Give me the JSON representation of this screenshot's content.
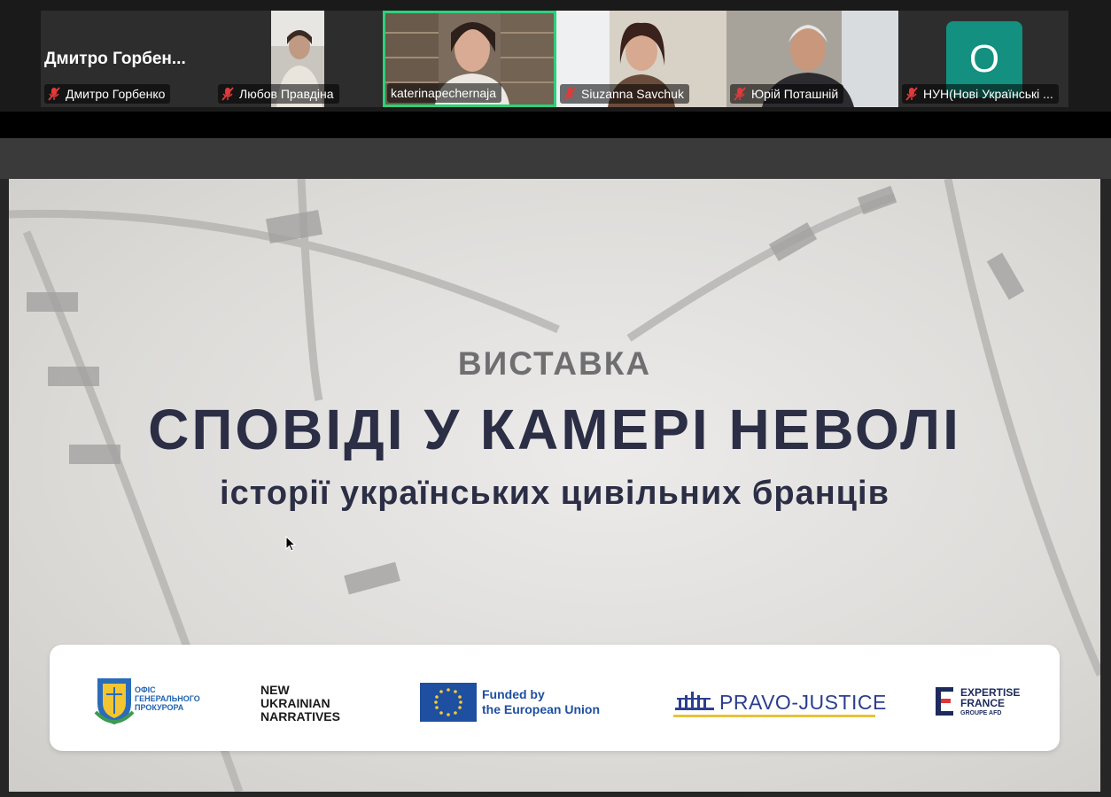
{
  "participants": [
    {
      "big_name": "Дмитро Горбен...",
      "name": "Дмитро Горбенко",
      "muted": true
    },
    {
      "name": "Любов Правдіна",
      "muted": true
    },
    {
      "name": "katerinapechernaja",
      "muted": false,
      "active_speaker": true
    },
    {
      "name": "Siuzanna Savchuk",
      "muted": true
    },
    {
      "name": "Юрій Поташній",
      "muted": true
    },
    {
      "name": "НУН(Нові Українські ...",
      "muted": true,
      "avatar_letter": "О"
    }
  ],
  "slide": {
    "subtitle_top": "ВИСТАВКА",
    "title": "СПОВІДІ У КАМЕРІ НЕВОЛІ",
    "subtitle": "історії українських цивільних бранців",
    "logos": {
      "ogp_line1": "ОФІС",
      "ogp_line2": "ГЕНЕРАЛЬНОГО",
      "ogp_line3": "ПРОКУРОРА",
      "nun_line1": "NEW",
      "nun_line2": "UKRAINIAN",
      "nun_line3": "NARRATIVES",
      "eu_line1": "Funded by",
      "eu_line2": "the European Union",
      "pravo": "PRAVO-JUSTICE",
      "ef_line1": "EXPERTISE",
      "ef_line2": "FRANCE",
      "ef_line3": "GROUPE AFD"
    }
  },
  "colors": {
    "active_border": "#2fd07a",
    "avatar_bg": "#13907f",
    "title_color": "#2b2e45",
    "mute_icon": "#e03a3a",
    "eu_blue": "#1f4fa0"
  }
}
